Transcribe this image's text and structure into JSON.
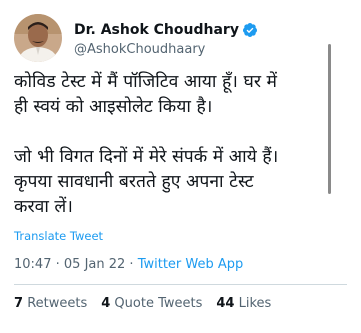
{
  "author": {
    "display_name": "Dr. Ashok Choudhary",
    "handle": "@AshokChoudhaary",
    "verified_icon": "verified-badge-icon",
    "avatar": "avatar"
  },
  "tweet": {
    "paragraph_1_line_1": "कोविड टेस्ट में मैं पॉजिटिव आया हूँ। घर में",
    "paragraph_1_line_2": "ही स्वयं को आइसोलेट किया है।",
    "paragraph_2_line_1": "जो भी विगत दिनों में मेरे संपर्क में आये हैं।",
    "paragraph_2_line_2": "कृपया सावधानी बरतते हुए अपना टेस्ट",
    "paragraph_2_line_3": "करवा लें।",
    "translate_label": "Translate Tweet",
    "time": "10:47",
    "separator": "·",
    "date": "05 Jan 22",
    "source": "Twitter Web App"
  },
  "stats": {
    "retweets_count": "7",
    "retweets_label": "Retweets",
    "quotes_count": "4",
    "quotes_label": "Quote Tweets",
    "likes_count": "44",
    "likes_label": "Likes"
  },
  "colors": {
    "accent": "#1d9bf0",
    "text": "#0f1419",
    "secondary": "#536471"
  }
}
